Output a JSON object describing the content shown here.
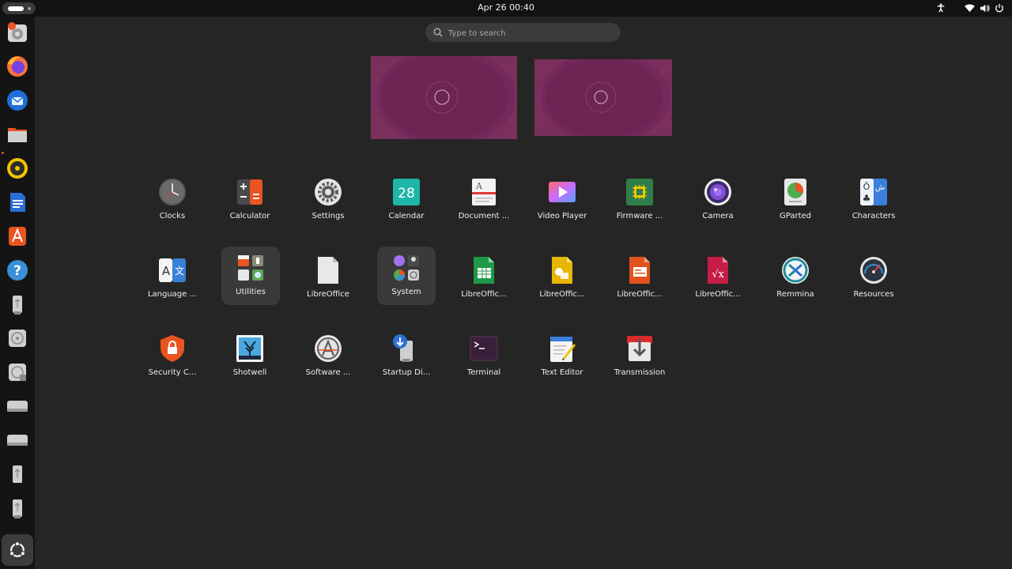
{
  "topbar": {
    "clock": "Apr 26  00:40"
  },
  "search": {
    "placeholder": "Type to search"
  },
  "apps": {
    "row1": [
      "Clocks",
      "Calculator",
      "Settings",
      "Calendar",
      "Document ...",
      "Video Player",
      "Firmware ...",
      "Camera",
      "GParted",
      "Characters"
    ],
    "row2": [
      "Language ...",
      "Utilities",
      "LibreOffice",
      "System",
      "LibreOffic...",
      "LibreOffic...",
      "LibreOffic...",
      "LibreOffic...",
      "Remmina",
      "Resources"
    ],
    "row3": [
      "Security C...",
      "Shotwell",
      "Software ...",
      "Startup Di...",
      "Terminal",
      "Text Editor",
      "Transmission"
    ]
  },
  "calendar_icon_day": "28",
  "colors": {
    "accent": "#e95420",
    "wallpaper": "#7a2f5c",
    "background": "#252525"
  }
}
